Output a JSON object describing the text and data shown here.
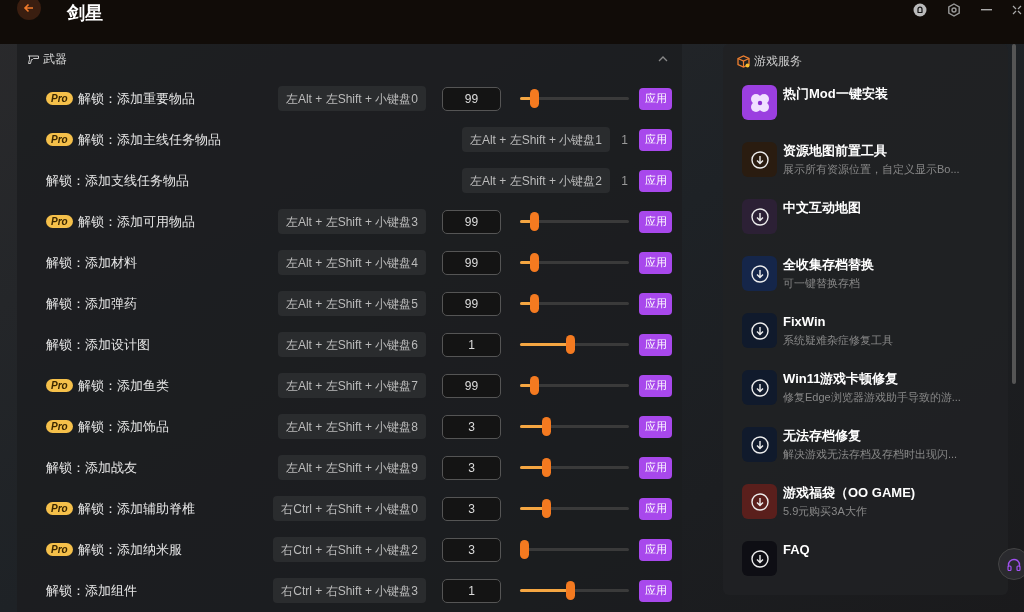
{
  "window": {
    "title": "剑星"
  },
  "weapons_panel": {
    "title": "武器",
    "expanded": true,
    "rows": [
      {
        "kind": "slider",
        "badge": "Pro",
        "label": "解锁：添加重要物品",
        "hotkey": "左Alt + 左Shift + 小键盘0",
        "value": "99",
        "level": 0.1,
        "button": "应用"
      },
      {
        "kind": "fixed",
        "badge": "Pro",
        "label": "解锁：添加主线任务物品",
        "hotkey": "左Alt + 左Shift + 小键盘1",
        "value": "1",
        "button": "应用"
      },
      {
        "kind": "fixed",
        "label": "解锁：添加支线任务物品",
        "hotkey": "左Alt + 左Shift + 小键盘2",
        "value": "1",
        "button": "应用"
      },
      {
        "kind": "slider",
        "badge": "Pro",
        "label": "解锁：添加可用物品",
        "hotkey": "左Alt + 左Shift + 小键盘3",
        "value": "99",
        "level": 0.1,
        "button": "应用"
      },
      {
        "kind": "slider",
        "label": "解锁：添加材料",
        "hotkey": "左Alt + 左Shift + 小键盘4",
        "value": "99",
        "level": 0.1,
        "button": "应用"
      },
      {
        "kind": "slider",
        "label": "解锁：添加弹药",
        "hotkey": "左Alt + 左Shift + 小键盘5",
        "value": "99",
        "level": 0.1,
        "button": "应用"
      },
      {
        "kind": "slider",
        "label": "解锁：添加设计图",
        "hotkey": "左Alt + 左Shift + 小键盘6",
        "value": "1",
        "level": 0.46,
        "button": "应用"
      },
      {
        "kind": "slider",
        "badge": "Pro",
        "label": "解锁：添加鱼类",
        "hotkey": "左Alt + 左Shift + 小键盘7",
        "value": "99",
        "level": 0.1,
        "button": "应用"
      },
      {
        "kind": "slider",
        "badge": "Pro",
        "label": "解锁：添加饰品",
        "hotkey": "左Alt + 左Shift + 小键盘8",
        "value": "3",
        "level": 0.22,
        "button": "应用"
      },
      {
        "kind": "slider",
        "label": "解锁：添加战友",
        "hotkey": "左Alt + 左Shift + 小键盘9",
        "value": "3",
        "level": 0.22,
        "button": "应用"
      },
      {
        "kind": "slider",
        "badge": "Pro",
        "label": "解锁：添加辅助脊椎",
        "hotkey": "右Ctrl + 右Shift + 小键盘0",
        "value": "3",
        "level": 0.22,
        "button": "应用"
      },
      {
        "kind": "slider",
        "badge": "Pro",
        "label": "解锁：添加纳米服",
        "hotkey": "右Ctrl + 右Shift + 小键盘2",
        "value": "3",
        "level": 0,
        "button": "应用"
      },
      {
        "kind": "slider",
        "label": "解锁：添加组件",
        "hotkey": "右Ctrl + 右Shift + 小键盘3",
        "value": "1",
        "level": 0.46,
        "button": "应用"
      }
    ]
  },
  "services_panel": {
    "title": "游戏服务",
    "items": [
      {
        "kind": "mod",
        "title": "热门Mod一键安装",
        "color": "#9b3fe0"
      },
      {
        "kind": "download",
        "title": "资源地图前置工具",
        "subtitle": "展示所有资源位置，自定义显示Bo...",
        "color": "#2a1c10"
      },
      {
        "kind": "download",
        "title": "中文互动地图",
        "color": "#2c2035"
      },
      {
        "kind": "download",
        "title": "全收集存档替换",
        "subtitle": "可一键替换存档",
        "color": "#15264a"
      },
      {
        "kind": "download",
        "title": "FixWin",
        "subtitle": "系统疑难杂症修复工具",
        "color": "#101a2c"
      },
      {
        "kind": "download",
        "title": "Win11游戏卡顿修复",
        "subtitle": "修复Edge浏览器游戏助手导致的游...",
        "color": "#101a2c"
      },
      {
        "kind": "download",
        "title": "无法存档修复",
        "subtitle": "解决游戏无法存档及存档时出现闪...",
        "color": "#101a2c"
      },
      {
        "kind": "download",
        "title": "游戏福袋（OO GAME)",
        "subtitle": "5.9元购买3A大作",
        "color": "#5a1f1c"
      },
      {
        "kind": "download",
        "title": "FAQ",
        "color": "#0e0e14"
      }
    ]
  }
}
